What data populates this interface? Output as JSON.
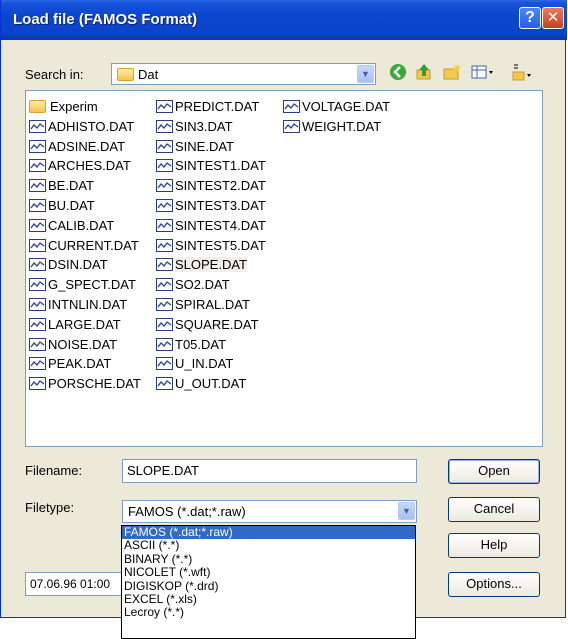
{
  "window": {
    "title": "Load file  (FAMOS Format)",
    "help_glyph": "?",
    "close_glyph": "✕"
  },
  "search": {
    "label": "Search in:",
    "folder": "Dat",
    "folder_icon": "folder-icon"
  },
  "toolbar": {
    "icons": [
      "back-icon",
      "up-folder-icon",
      "new-folder-icon",
      "view-menu-icon",
      "tools-icon"
    ]
  },
  "files": {
    "col1": [
      "Experim",
      "ADHISTO.DAT",
      "ADSINE.DAT",
      "ARCHES.DAT",
      "BE.DAT",
      "BU.DAT",
      "CALIB.DAT",
      "CURRENT.DAT",
      "DSIN.DAT",
      "G_SPECT.DAT",
      "INTNLIN.DAT",
      "LARGE.DAT",
      "NOISE.DAT",
      "PEAK.DAT",
      "PORSCHE.DAT"
    ],
    "col2": [
      "PREDICT.DAT",
      "SIN3.DAT",
      "SINE.DAT",
      "SINTEST1.DAT",
      "SINTEST2.DAT",
      "SINTEST3.DAT",
      "SINTEST4.DAT",
      "SINTEST5.DAT",
      "SLOPE.DAT",
      "SO2.DAT",
      "SPIRAL.DAT",
      "SQUARE.DAT",
      "T05.DAT",
      "U_IN.DAT",
      "U_OUT.DAT"
    ],
    "col3": [
      "VOLTAGE.DAT",
      "WEIGHT.DAT"
    ],
    "selected": "SLOPE.DAT"
  },
  "filename": {
    "label": "Filename:",
    "value": "SLOPE.DAT"
  },
  "filetype": {
    "label": "Filetype:",
    "value": "FAMOS  (*.dat;*.raw)",
    "options": [
      "FAMOS  (*.dat;*.raw)",
      "ASCII    (*.*)",
      "BINARY  (*.*)",
      "NICOLET  (*.wft)",
      "DIGISKOP  (*.drd)",
      "EXCEL  (*.xls)",
      "Lecroy   (*.*)"
    ]
  },
  "status": {
    "text": "07.06.96 01:00"
  },
  "buttons": {
    "open": "Open",
    "cancel": "Cancel",
    "help": "Help",
    "options": "Options..."
  },
  "colors": {
    "titlebar": "#0a46d0",
    "dialog_bg": "#ece9d8",
    "highlight": "#316ac5"
  }
}
